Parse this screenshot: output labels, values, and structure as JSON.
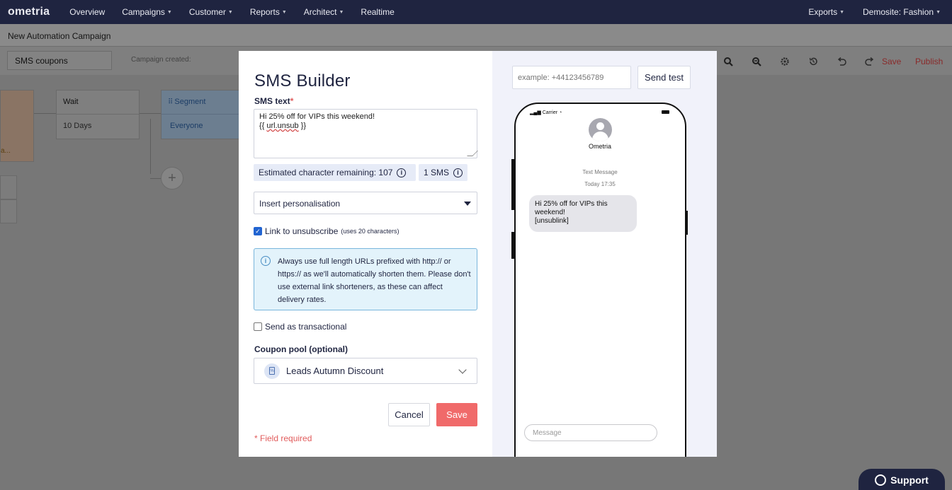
{
  "nav": {
    "logo": "ometria",
    "items": [
      {
        "label": "Overview",
        "has_caret": false
      },
      {
        "label": "Campaigns",
        "has_caret": true
      },
      {
        "label": "Customer",
        "has_caret": true
      },
      {
        "label": "Reports",
        "has_caret": true
      },
      {
        "label": "Architect",
        "has_caret": true
      },
      {
        "label": "Realtime",
        "has_caret": false
      }
    ],
    "right_items": [
      {
        "label": "Exports"
      },
      {
        "label": "Demosite: Fashion"
      }
    ]
  },
  "page": {
    "title": "New Automation Campaign",
    "campaign_name": "SMS coupons",
    "campaign_created": "Campaign created:",
    "save_label": "Save",
    "publish_label": "Publish"
  },
  "canvas": {
    "orange_node_text": "a...",
    "wait_node": {
      "title": "Wait",
      "body": "10 Days"
    },
    "segment_node": {
      "title": "Segment",
      "body": "Everyone"
    },
    "plus": "+"
  },
  "modal": {
    "title": "SMS Builder",
    "sms_text_label": "SMS text",
    "required_mark": "*",
    "sms_text_line1": "Hi 25% off for VIPs this weekend!",
    "sms_text_line2_prefix": "{{ ",
    "sms_text_line2_token": "url.unsub",
    "sms_text_line2_suffix": " }}",
    "chars_remaining": "Estimated character remaining: 107",
    "sms_count": "1 SMS",
    "insert_personalisation": "Insert personalisation",
    "link_unsubscribe_label": "Link to unsubscribe",
    "link_unsubscribe_note": "(uses 20 characters)",
    "link_unsubscribe_checked": true,
    "info_text": "Always use full length URLs prefixed with http:// or https:// as we'll automatically shorten them. Please don't use external link shorteners, as these can affect delivery rates.",
    "transactional_label": "Send as transactional",
    "transactional_checked": false,
    "coupon_pool_label": "Coupon pool (optional)",
    "coupon_pool_value": "Leads Autumn Discount",
    "cancel_label": "Cancel",
    "save_label": "Save",
    "field_required": "* Field required"
  },
  "preview": {
    "phone_placeholder": "example: +44123456789",
    "send_test_label": "Send test",
    "carrier": "Carrier",
    "contact_name": "Ometria",
    "message_type": "Text Message",
    "timestamp": "Today 17:35",
    "bubble_text": "Hi 25% off for VIPs this\nweekend!\n[unsublink]",
    "message_placeholder": "Message"
  },
  "support": {
    "label": "Support"
  },
  "colors": {
    "navy": "#1f2440",
    "save_red": "#f06a6a",
    "required_red": "#e15b5b",
    "info_bg": "#e3f3fb",
    "info_border": "#79b6dc",
    "checkbox_blue": "#2264d1",
    "preview_bg": "#f1f2fa"
  }
}
